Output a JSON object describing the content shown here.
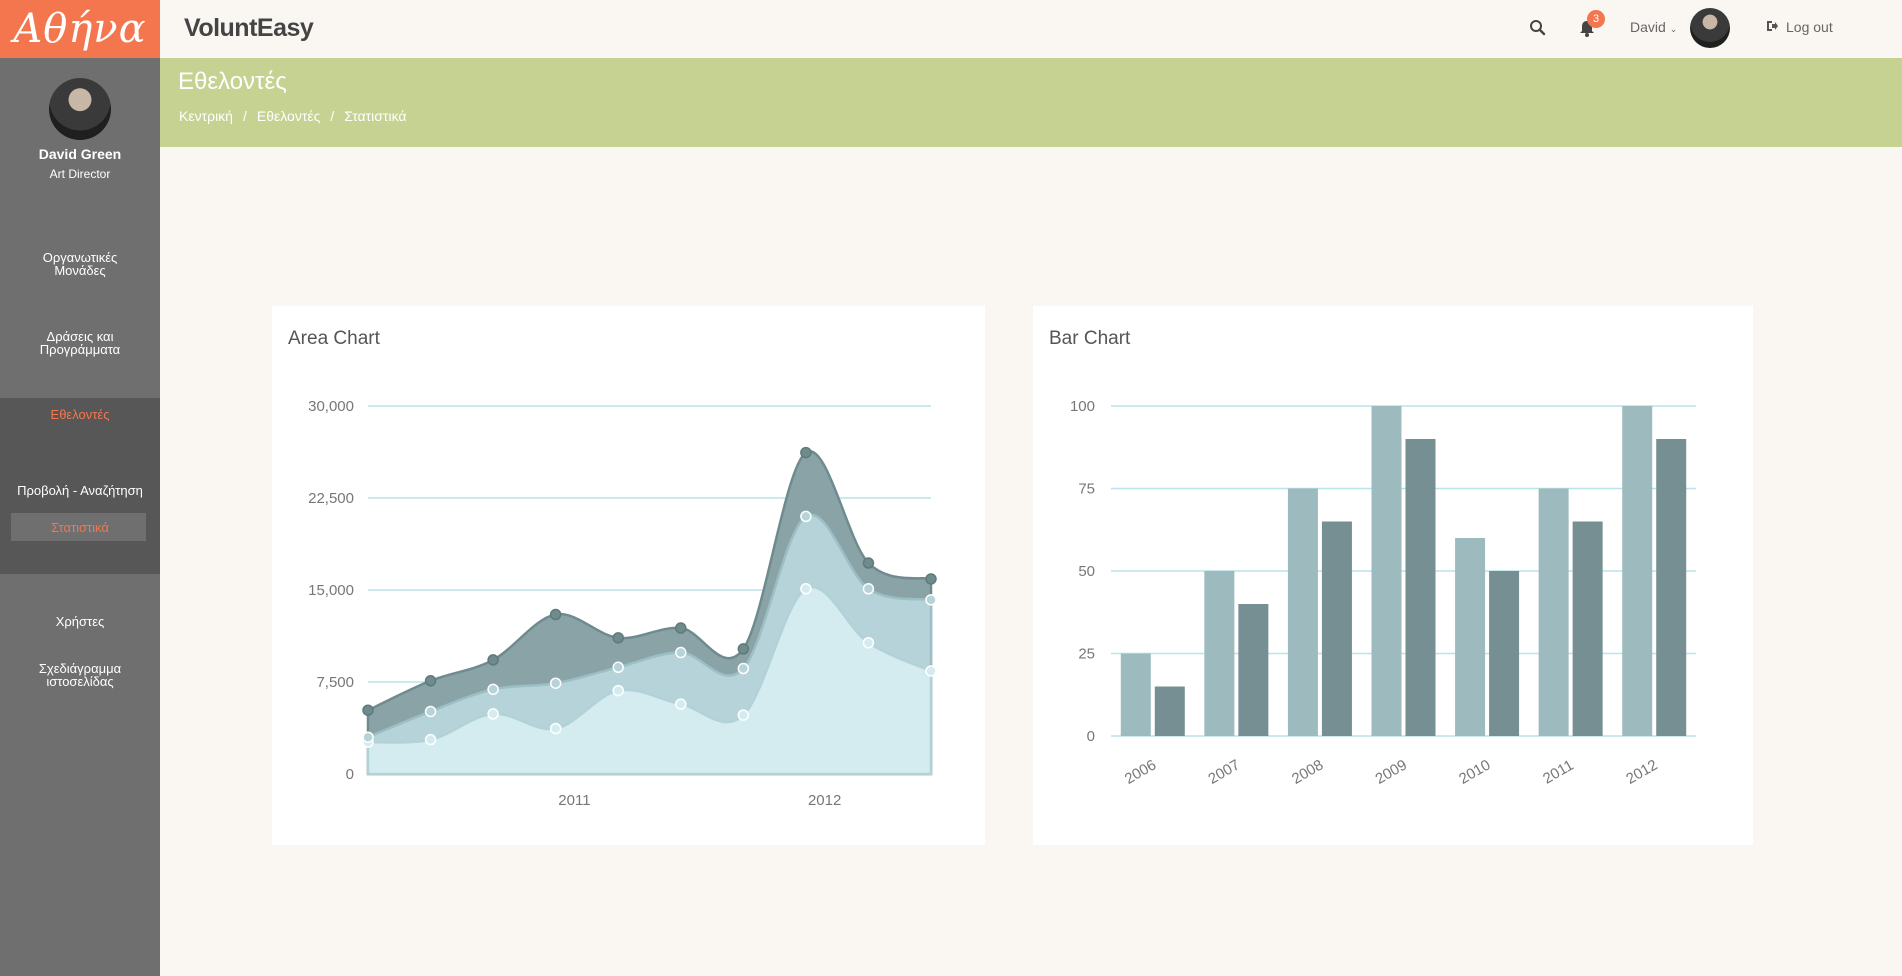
{
  "brand": {
    "logo_text": "Αθήνα"
  },
  "app": {
    "name_part1": "Volunt",
    "name_part2": "Easy"
  },
  "topbar": {
    "notification_count": "3",
    "user_label": "David",
    "logout_label": "Log out"
  },
  "sidebar": {
    "user_name": "David Green",
    "user_role": "Art Director",
    "items": [
      {
        "label": "Οργανωτικές Μονάδες"
      },
      {
        "label": "Δράσεις και Προγράμματα"
      },
      {
        "label": "Εθελοντές"
      },
      {
        "label": "Προβολή - Αναζήτηση"
      },
      {
        "label": "Στατιστικά"
      },
      {
        "label": "Χρήστες"
      },
      {
        "label": "Σχεδιάγραμμα ιστοσελίδας"
      }
    ]
  },
  "page": {
    "title": "Εθελοντές",
    "breadcrumb": [
      "Κεντρική",
      "Εθελοντές",
      "Στατιστικά"
    ]
  },
  "colors": {
    "accent": "#f4764e",
    "header_bar": "#c5d292",
    "sidebar": "#6f6f6f",
    "series_light": "#d4ecf0",
    "series_mid": "#b5d3d8",
    "series_dark": "#8aa3a6",
    "bar_light": "#9dbbbe",
    "bar_dark": "#768f92",
    "gridline": "#b8e3ea"
  },
  "chart_data": [
    {
      "type": "area",
      "title": "Area Chart",
      "x_ticks": [
        {
          "label": "2011",
          "at": 3.3
        },
        {
          "label": "2012",
          "at": 7.3
        }
      ],
      "y_ticks": [
        "0",
        "7,500",
        "15,000",
        "22,500",
        "30,000"
      ],
      "ylim": [
        0,
        30000
      ],
      "x_count": 10,
      "stacked": true,
      "grid": true,
      "series": [
        {
          "values": [
            2600,
            2800,
            4900,
            3700,
            6800,
            5700,
            4800,
            15100,
            10700,
            8400
          ]
        },
        {
          "values": [
            3000,
            5100,
            6900,
            7400,
            8700,
            9900,
            8600,
            21000,
            15100,
            14200
          ]
        },
        {
          "values": [
            5200,
            7600,
            9300,
            13000,
            11100,
            11900,
            10200,
            26200,
            17200,
            15900
          ]
        }
      ]
    },
    {
      "type": "bar",
      "title": "Bar Chart",
      "categories": [
        "2006",
        "2007",
        "2008",
        "2009",
        "2010",
        "2011",
        "2012"
      ],
      "y_ticks": [
        "0",
        "25",
        "50",
        "75",
        "100"
      ],
      "ylim": [
        0,
        100
      ],
      "grid": true,
      "series": [
        {
          "values": [
            25,
            50,
            75,
            100,
            60,
            75,
            100
          ]
        },
        {
          "values": [
            15,
            40,
            65,
            90,
            50,
            65,
            90
          ]
        }
      ]
    }
  ]
}
